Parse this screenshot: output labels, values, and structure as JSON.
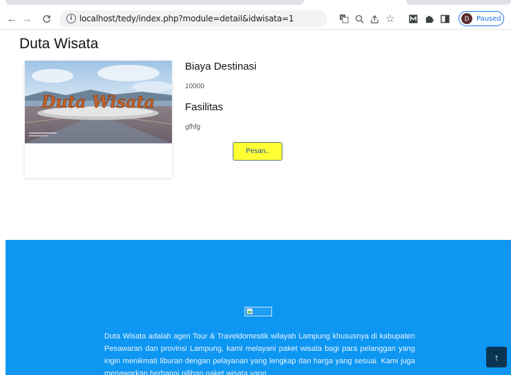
{
  "browser": {
    "url": "localhost/tedy/index.php?module=detail&idwisata=1",
    "profile_initial": "D",
    "profile_status": "Paused",
    "icons": {
      "back": "back-arrow-icon",
      "forward": "forward-arrow-icon",
      "reload": "reload-icon",
      "info": "info-icon",
      "translate": "translate-icon",
      "zoom": "zoom-icon",
      "share": "share-icon",
      "bookmark": "star-icon",
      "extension_m": "extension-m-icon",
      "extensions": "puzzle-icon",
      "sidepanel": "side-panel-icon"
    }
  },
  "page": {
    "title": "Duta Wisata",
    "card": {
      "image_caption": "Duta Wisata"
    },
    "biaya_heading": "Biaya Destinasi",
    "biaya_value": "10000",
    "fasilitas_heading": "Fasilitas",
    "fasilitas_value": "gfhfg",
    "order_button": "Pesan.."
  },
  "footer": {
    "description": "Duta Wisata adalah agen Tour & Traveldomestik wilayah Lampung khususnya di kabupaten Pesawaran dan provinsi Lampung, kami melayani paket wisata bagi para pelanggan yang ingin menikmati liburan dengan pelayanan yang lengkap dan harga yang sesuai. Kami juga menawarkan berbagai pilihan paket wisata yang",
    "scroll_top_icon": "arrow-up-icon"
  },
  "colors": {
    "footer_bg": "#0d96f2",
    "order_button_bg": "#ffff33",
    "scroll_top_bg": "#0a3552"
  }
}
